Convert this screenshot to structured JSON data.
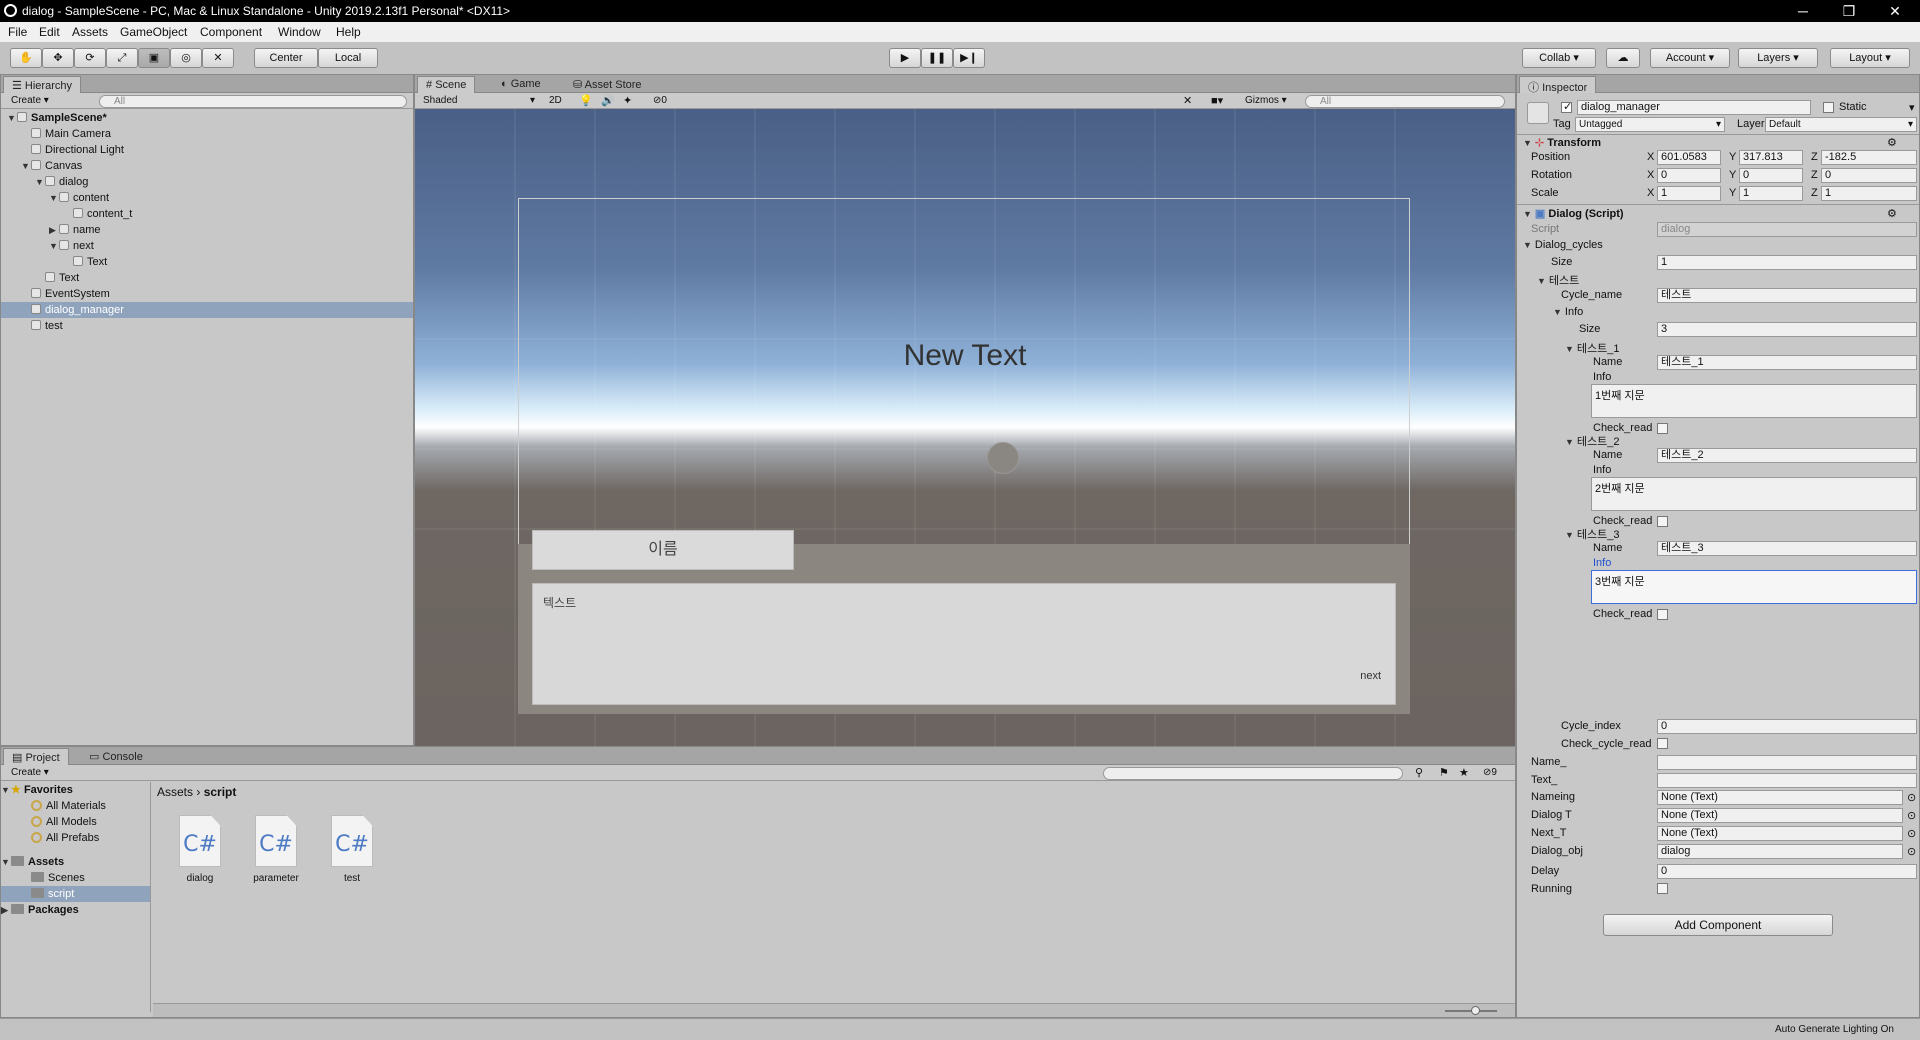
{
  "titlebar": {
    "title": "dialog - SampleScene - PC, Mac & Linux Standalone - Unity 2019.2.13f1 Personal* <DX11>",
    "minimize": "─",
    "restore": "❐",
    "close": "✕"
  },
  "menu": [
    "File",
    "Edit",
    "Assets",
    "GameObject",
    "Component",
    "Window",
    "Help"
  ],
  "toolbar": {
    "center": "Center",
    "local": "Local",
    "collab": "Collab",
    "account": "Account",
    "layers": "Layers",
    "layout": "Layout"
  },
  "hierarchy": {
    "tab": "Hierarchy",
    "create": "Create",
    "search": "All",
    "items": [
      {
        "label": "SampleScene*",
        "depth": 0,
        "arrow": "▼",
        "scene": true
      },
      {
        "label": "Main Camera",
        "depth": 1,
        "arrow": ""
      },
      {
        "label": "Directional Light",
        "depth": 1,
        "arrow": ""
      },
      {
        "label": "Canvas",
        "depth": 1,
        "arrow": "▼"
      },
      {
        "label": "dialog",
        "depth": 2,
        "arrow": "▼"
      },
      {
        "label": "content",
        "depth": 3,
        "arrow": "▼"
      },
      {
        "label": "content_t",
        "depth": 4,
        "arrow": ""
      },
      {
        "label": "name",
        "depth": 3,
        "arrow": "▶"
      },
      {
        "label": "next",
        "depth": 3,
        "arrow": "▼"
      },
      {
        "label": "Text",
        "depth": 4,
        "arrow": ""
      },
      {
        "label": "Text",
        "depth": 2,
        "arrow": ""
      },
      {
        "label": "EventSystem",
        "depth": 1,
        "arrow": ""
      },
      {
        "label": "dialog_manager",
        "depth": 1,
        "arrow": "",
        "selected": true
      },
      {
        "label": "test",
        "depth": 1,
        "arrow": ""
      }
    ]
  },
  "scene_tabs": {
    "scene": "Scene",
    "game": "Game",
    "store": "Asset Store",
    "shaded": "Shaded",
    "mode2d": "2D",
    "gizmos": "Gizmos",
    "search": "All",
    "hidden": "0"
  },
  "scene": {
    "new_text": "New Text",
    "name_label": "이름",
    "body_text": "텍스트",
    "next_label": "next"
  },
  "project": {
    "tab": "Project",
    "console": "Console",
    "create": "Create",
    "hidden_count": "9",
    "favorites": "Favorites",
    "fav_items": [
      "All Materials",
      "All Models",
      "All Prefabs"
    ],
    "assets": "Assets",
    "asset_folders": [
      "Scenes",
      "script"
    ],
    "packages": "Packages",
    "breadcrumb": [
      "Assets",
      "script"
    ],
    "files": [
      "dialog",
      "parameter",
      "test"
    ],
    "file_glyph": "C#"
  },
  "inspector": {
    "tab": "Inspector",
    "name": "dialog_manager",
    "static": "Static",
    "tag_label": "Tag",
    "tag": "Untagged",
    "layer_label": "Layer",
    "layer": "Default",
    "transform": {
      "title": "Transform",
      "position": {
        "label": "Position",
        "x": "601.0583",
        "y": "317.813",
        "z": "-182.5"
      },
      "rotation": {
        "label": "Rotation",
        "x": "0",
        "y": "0",
        "z": "0"
      },
      "scale": {
        "label": "Scale",
        "x": "1",
        "y": "1",
        "z": "1"
      }
    },
    "script_comp": {
      "title": "Dialog (Script)",
      "script_label": "Script",
      "script": "dialog"
    },
    "dialog_cycles": "Dialog_cycles",
    "size_label": "Size",
    "size": "1",
    "cycle_group": "테스트",
    "cycle_name_label": "Cycle_name",
    "cycle_name": "테스트",
    "info_label": "Info",
    "info_size": "3",
    "entries": [
      {
        "header": "테스트_1",
        "name_label": "Name",
        "name": "테스트_1",
        "info_label": "Info",
        "info": "1번째 지문",
        "check_label": "Check_read"
      },
      {
        "header": "테스트_2",
        "name_label": "Name",
        "name": "테스트_2",
        "info_label": "Info",
        "info": "2번째 지문",
        "check_label": "Check_read"
      },
      {
        "header": "테스트_3",
        "name_label": "Name",
        "name": "테스트_3",
        "info_label": "Info",
        "info": "3번째 지문",
        "check_label": "Check_read"
      }
    ],
    "cycle_index_label": "Cycle_index",
    "cycle_index": "0",
    "check_cycle_label": "Check_cycle_read",
    "name_label": "Name_",
    "text_label": "Text_",
    "refs": [
      {
        "label": "Nameing",
        "value": "None (Text)"
      },
      {
        "label": "Dialog T",
        "value": "None (Text)"
      },
      {
        "label": "Next_T",
        "value": "None (Text)"
      },
      {
        "label": "Dialog_obj",
        "value": "dialog"
      }
    ],
    "delay_label": "Delay",
    "delay": "0",
    "running_label": "Running",
    "add_component": "Add Component"
  },
  "status": {
    "text": "Auto Generate Lighting On"
  },
  "colors": {
    "selection": "#8fa3bd",
    "focus": "#3d6fd6",
    "link": "#1f4fd1"
  }
}
